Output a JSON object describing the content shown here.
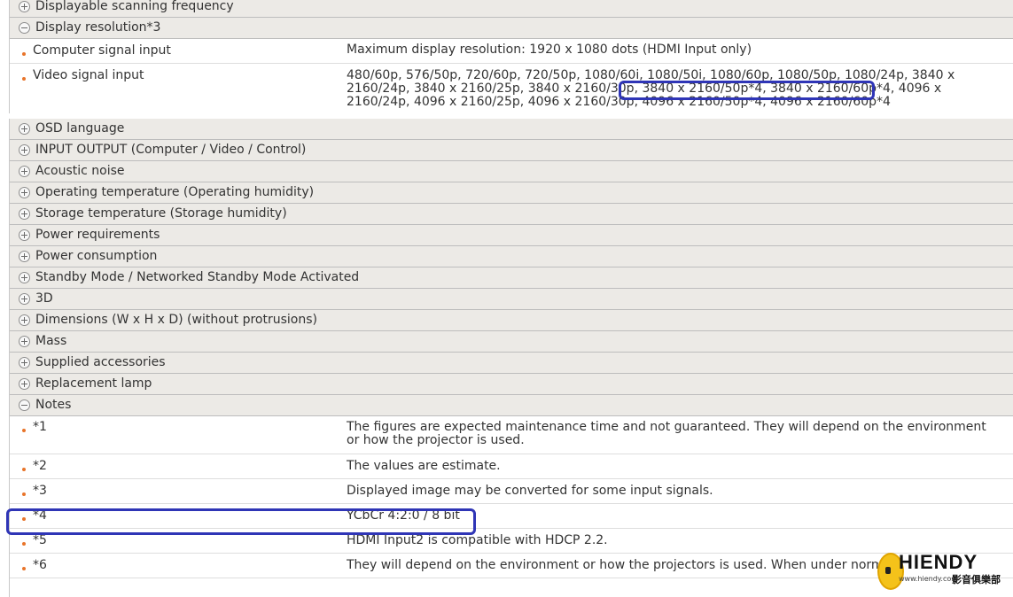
{
  "top_section": {
    "scanning_header": "Displayable scanning frequency",
    "resolution_header": "Display resolution*3",
    "rows": [
      {
        "label": "Computer signal input",
        "value": "Maximum display resolution: 1920 x 1080 dots (HDMI Input only)"
      },
      {
        "label": "Video signal input",
        "value": "480/60p, 576/50p, 720/60p, 720/50p, 1080/60i, 1080/50i, 1080/60p, 1080/50p, 1080/24p, 3840 x 2160/24p, 3840 x 2160/25p, 3840 x 2160/30p, 3840 x 2160/50p*4, 3840 x 2160/60p*4, 4096 x 2160/24p, 4096 x 2160/25p, 4096 x 2160/30p, 4096 x 2160/50p*4, 4096 x 2160/60p*4"
      }
    ]
  },
  "sections": [
    "OSD language",
    "INPUT OUTPUT (Computer / Video / Control)",
    "Acoustic noise",
    "Operating temperature (Operating humidity)",
    "Storage temperature (Storage humidity)",
    "Power requirements",
    "Power consumption",
    "Standby Mode / Networked Standby Mode Activated",
    "3D",
    "Dimensions (W x H x D) (without protrusions)",
    "Mass",
    "Supplied accessories",
    "Replacement lamp"
  ],
  "notes": {
    "header": "Notes",
    "rows": [
      {
        "label": "*1",
        "value": "The figures are expected maintenance time and not guaranteed. They will depend on the environment or how the projector is used."
      },
      {
        "label": "*2",
        "value": "The values are estimate."
      },
      {
        "label": "*3",
        "value": "Displayed image may be converted for some input signals."
      },
      {
        "label": "*4",
        "value": "YCbCr 4:2:0 / 8 bit"
      },
      {
        "label": "*5",
        "value": "HDMI Input2 is compatible with HDCP 2.2."
      },
      {
        "label": "*6",
        "value": "They will depend on the environment or how the projectors is used. When under norm"
      }
    ]
  },
  "watermark": {
    "brand": "HIENDY",
    "site": "www.hiendy.com",
    "club": "影音俱樂部"
  },
  "colors": {
    "header_bg": "#eceae6",
    "bullet": "#e8742a",
    "highlight": "#2f35b6"
  }
}
